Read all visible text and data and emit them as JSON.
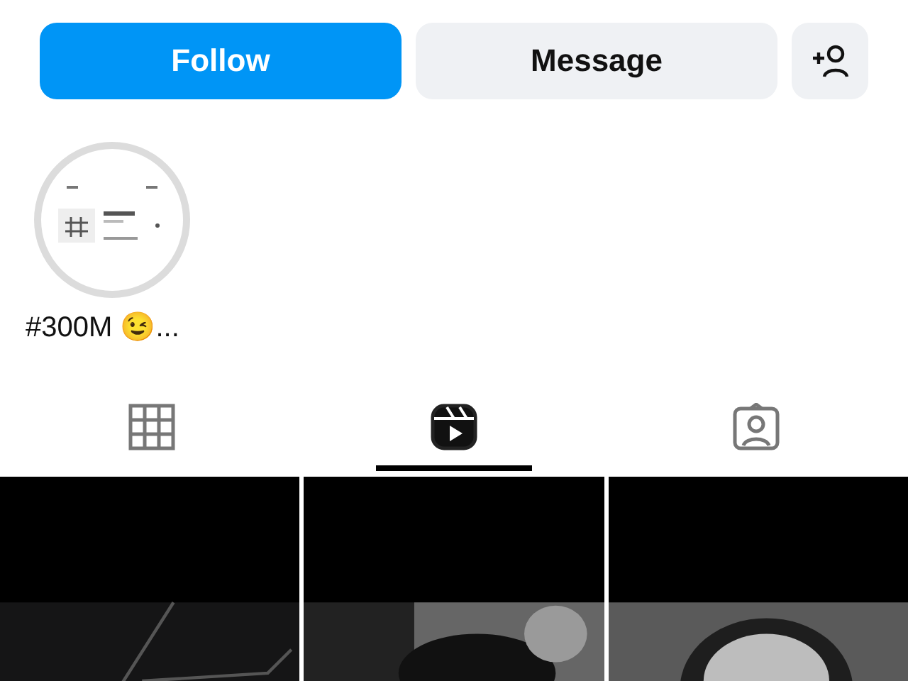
{
  "actions": {
    "follow": "Follow",
    "message": "Message"
  },
  "highlights": [
    {
      "label": "#300M 😉..."
    }
  ],
  "tabs": [
    {
      "kind": "grid",
      "selected": false
    },
    {
      "kind": "reels",
      "selected": true
    },
    {
      "kind": "tagged",
      "selected": false
    }
  ]
}
